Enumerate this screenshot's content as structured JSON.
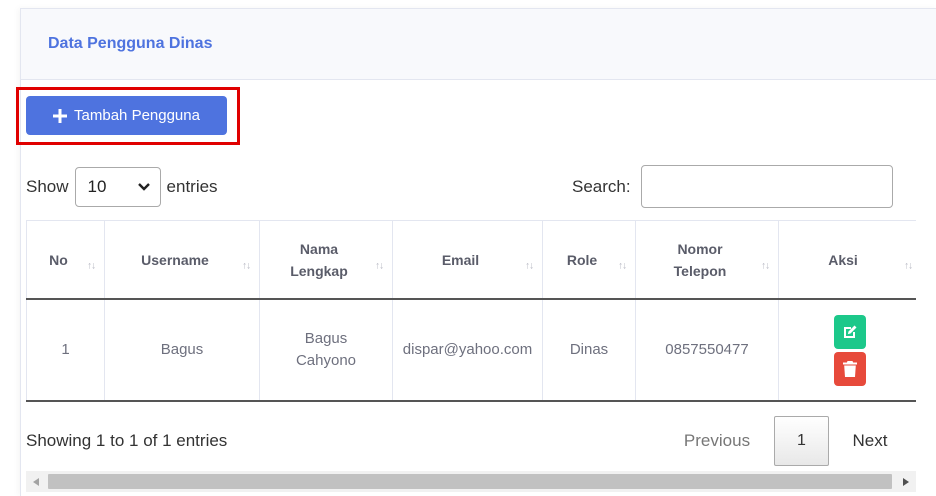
{
  "header": {
    "title": "Data Pengguna Dinas"
  },
  "toolbar": {
    "add_label": "Tambah Pengguna"
  },
  "length": {
    "show_label": "Show",
    "selected": "10",
    "entries_label": "entries"
  },
  "search": {
    "label": "Search:",
    "value": "",
    "placeholder": ""
  },
  "table": {
    "columns": {
      "no": "No",
      "username": "Username",
      "nama_1": "Nama",
      "nama_2": "Lengkap",
      "email": "Email",
      "role": "Role",
      "telp_1": "Nomor",
      "telp_2": "Telepon",
      "aksi": "Aksi"
    },
    "rows": [
      {
        "no": "1",
        "username": "Bagus",
        "nama_1": "Bagus",
        "nama_2": "Cahyono",
        "email": "dispar@yahoo.com",
        "role": "Dinas",
        "telp": "0857550477"
      }
    ]
  },
  "footer": {
    "info": "Showing 1 to 1 of 1 entries",
    "prev": "Previous",
    "page": "1",
    "next": "Next"
  },
  "icons": {
    "plus": "plus-icon",
    "edit": "edit-icon",
    "delete": "trash-icon",
    "sort": "sort-icon",
    "select_chevron": "chevron-down-icon"
  },
  "colors": {
    "primary": "#4e73df",
    "success": "#1cc88a",
    "danger": "#e74a3b",
    "highlight": "#e00000"
  }
}
